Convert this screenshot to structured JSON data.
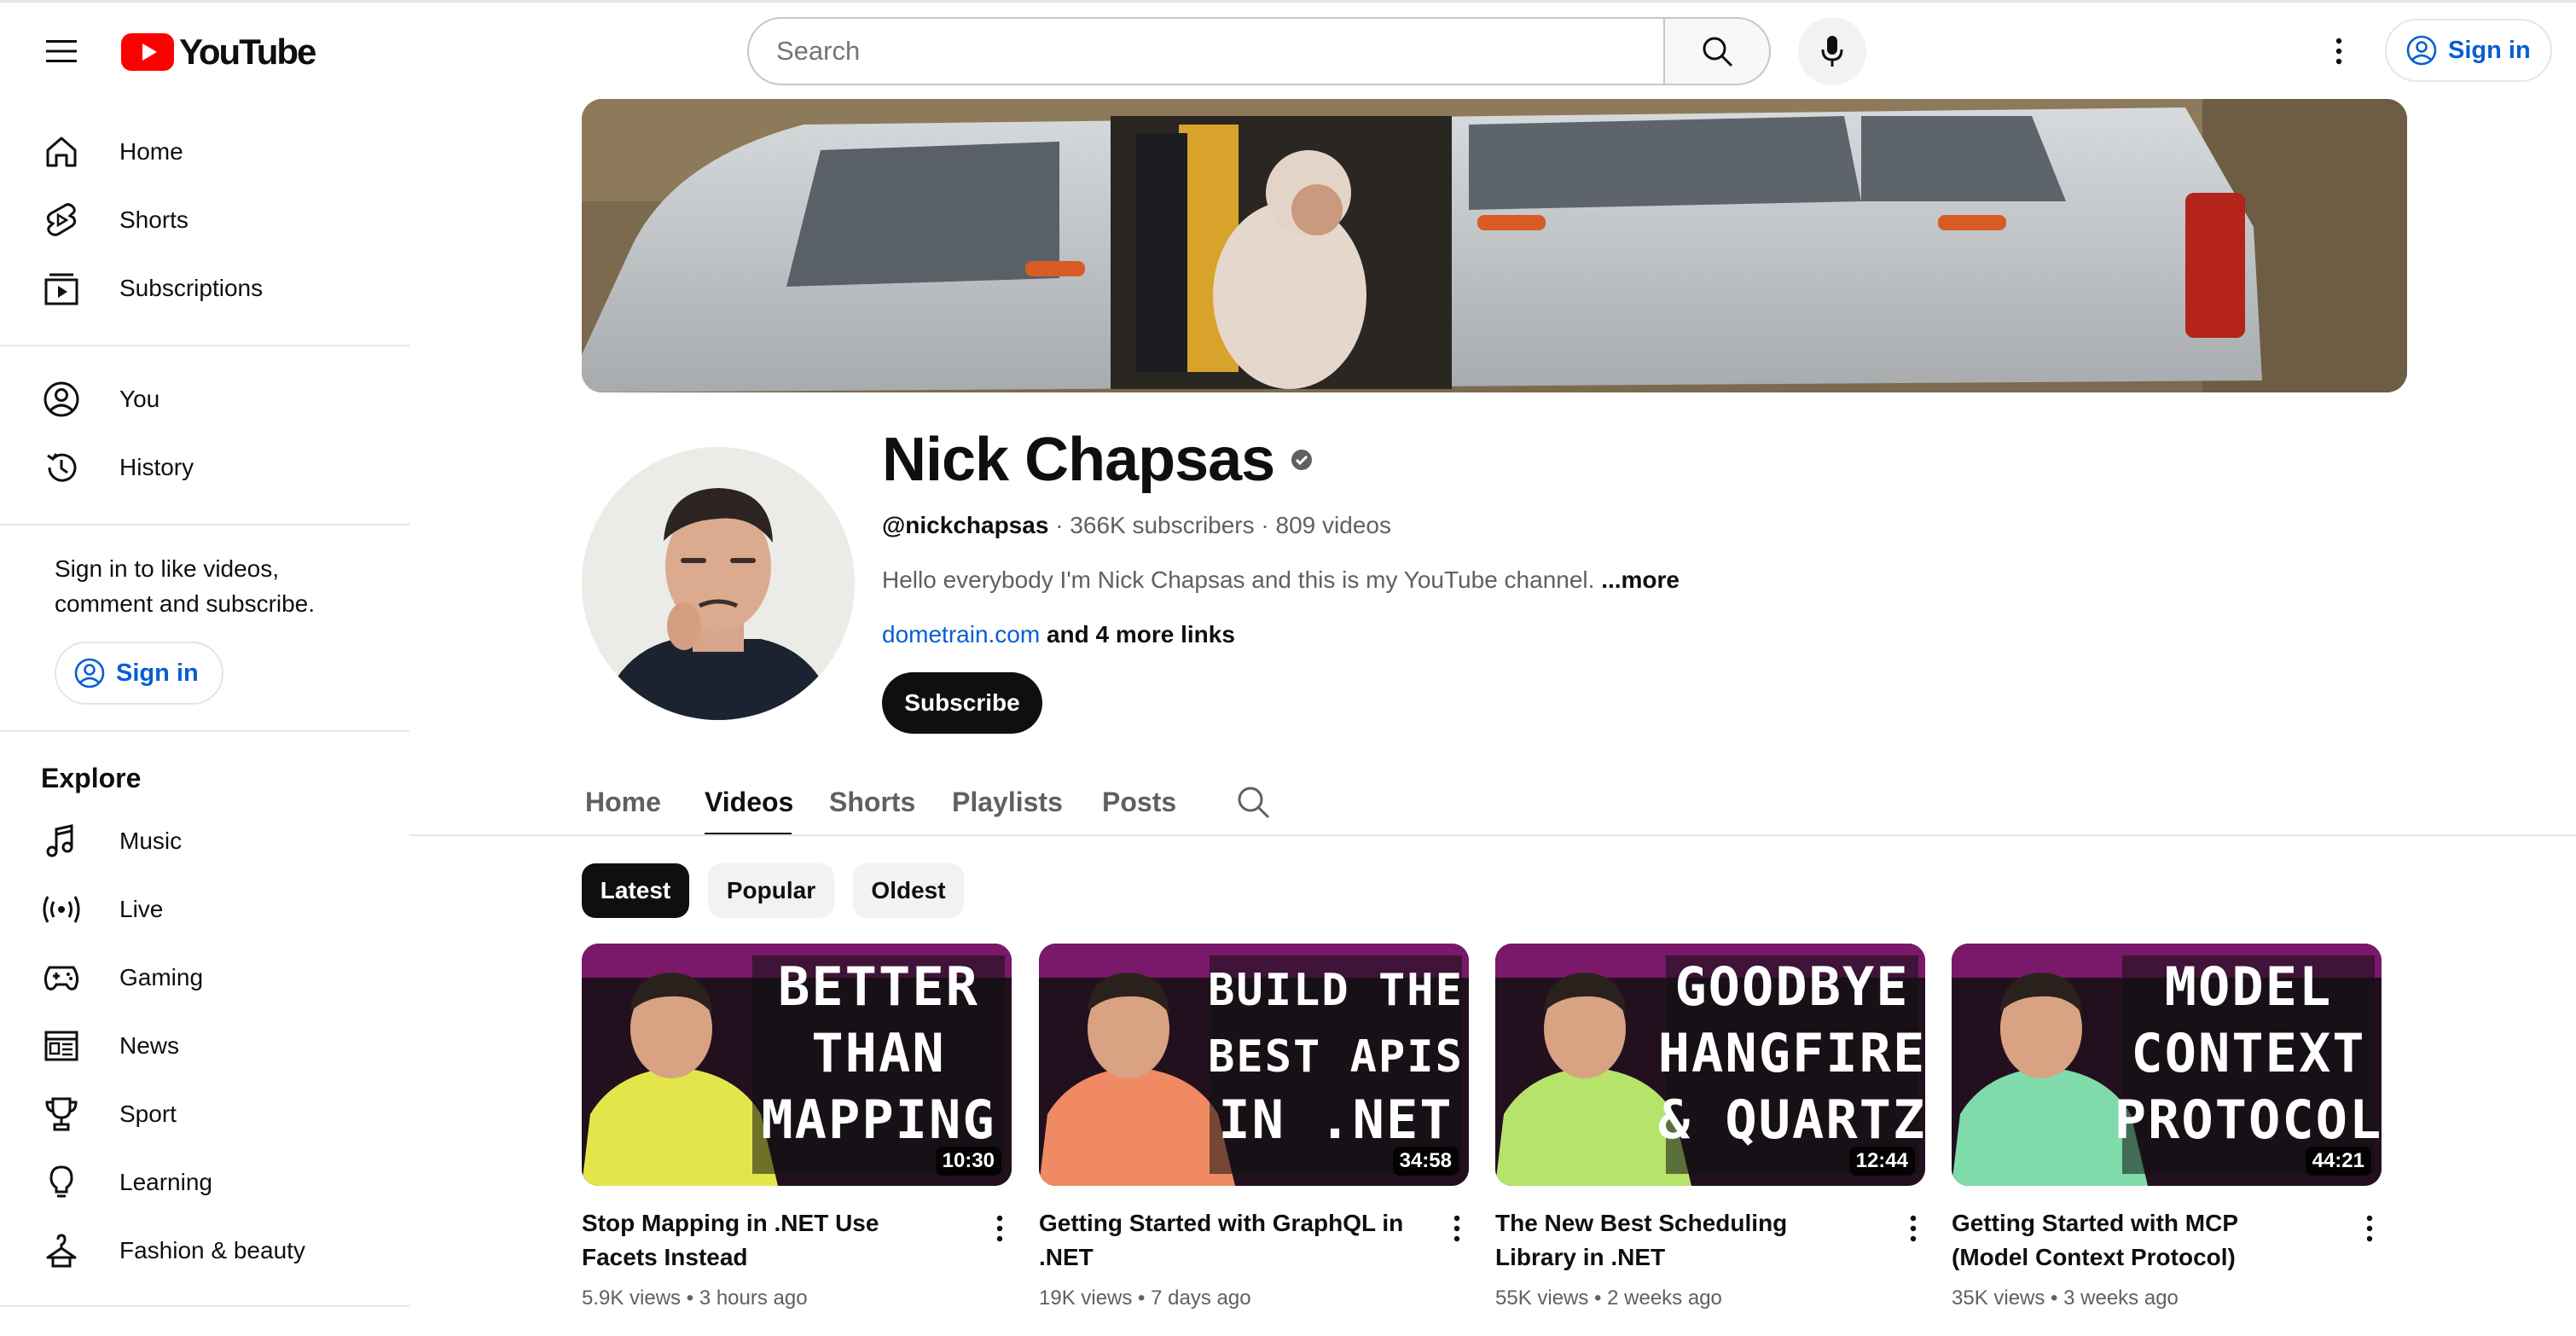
{
  "header": {
    "logo_text": "YouTube",
    "search_placeholder": "Search",
    "signin_label": "Sign in",
    "brand_color": "#ff0000",
    "link_color": "#065fd4"
  },
  "sidebar": {
    "primary": [
      {
        "label": "Home",
        "icon": "home-icon"
      },
      {
        "label": "Shorts",
        "icon": "shorts-icon"
      },
      {
        "label": "Subscriptions",
        "icon": "subscriptions-icon"
      }
    ],
    "secondary": [
      {
        "label": "You",
        "icon": "you-icon"
      },
      {
        "label": "History",
        "icon": "history-icon"
      }
    ],
    "signin_prompt": "Sign in to like videos, comment and subscribe.",
    "signin_label": "Sign in",
    "explore_title": "Explore",
    "explore": [
      {
        "label": "Music",
        "icon": "music-icon"
      },
      {
        "label": "Live",
        "icon": "live-icon"
      },
      {
        "label": "Gaming",
        "icon": "gaming-icon"
      },
      {
        "label": "News",
        "icon": "news-icon"
      },
      {
        "label": "Sport",
        "icon": "trophy-icon"
      },
      {
        "label": "Learning",
        "icon": "lightbulb-icon"
      },
      {
        "label": "Fashion & beauty",
        "icon": "hanger-icon"
      }
    ]
  },
  "channel": {
    "name": "Nick Chapsas",
    "handle": "@nickchapsas",
    "subscribers": "366K subscribers",
    "videos": "809 videos",
    "description": "Hello everybody I'm Nick Chapsas and this is my YouTube channel.",
    "more_label": "...more",
    "link": "dometrain.com",
    "extra_links": "and 4 more links",
    "subscribe_label": "Subscribe"
  },
  "tabs": [
    "Home",
    "Videos",
    "Shorts",
    "Playlists",
    "Posts"
  ],
  "active_tab": "Videos",
  "chips": [
    "Latest",
    "Popular",
    "Oldest"
  ],
  "active_chip": "Latest",
  "videos": [
    {
      "title": "Stop Mapping in .NET Use Facets Instead",
      "views": "5.9K views",
      "age": "3 hours ago",
      "duration": "10:30",
      "thumb_lines": [
        "BETTER",
        "THAN",
        "MAPPING"
      ],
      "hoodie_color": "#e3e64a"
    },
    {
      "title": "Getting Started with GraphQL in .NET",
      "views": "19K views",
      "age": "7 days ago",
      "duration": "34:58",
      "thumb_lines": [
        "BUILD THE",
        "BEST APIS",
        "IN .NET"
      ],
      "hoodie_color": "#f08a62"
    },
    {
      "title": "The New Best Scheduling Library in .NET",
      "views": "55K views",
      "age": "2 weeks ago",
      "duration": "12:44",
      "thumb_lines": [
        "GOODBYE",
        "HANGFIRE",
        "& QUARTZ"
      ],
      "hoodie_color": "#b6e36a"
    },
    {
      "title": "Getting Started with MCP (Model Context Protocol)",
      "views": "35K views",
      "age": "3 weeks ago",
      "duration": "44:21",
      "thumb_lines": [
        "MODEL",
        "CONTEXT",
        "PROTOCOL"
      ],
      "hoodie_color": "#7fdcaa"
    }
  ]
}
